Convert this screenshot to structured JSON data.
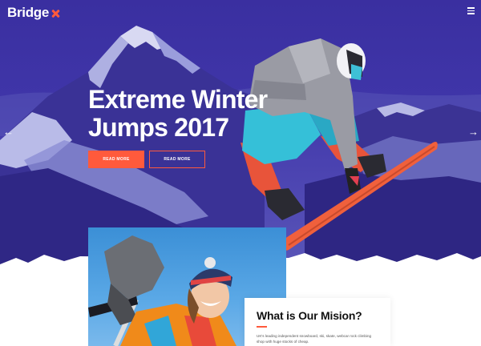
{
  "brand": {
    "name": "Bridge",
    "accent": "#ff5a3c"
  },
  "header": {
    "menu_icon": "hamburger-icon"
  },
  "hero": {
    "title_line1": "Extreme Winter",
    "title_line2": "Jumps 2017",
    "primary_button": "READ MORE",
    "secondary_button": "READ MORE",
    "prev_icon": "arrow-left-icon",
    "next_icon": "arrow-right-icon",
    "background_color": "#3f35a8"
  },
  "mission": {
    "title": "What is Our Mision?",
    "text": "UK's leading independent snowboard, ski, skate, webcar rock climbing shop with huge stocks of cheap."
  }
}
